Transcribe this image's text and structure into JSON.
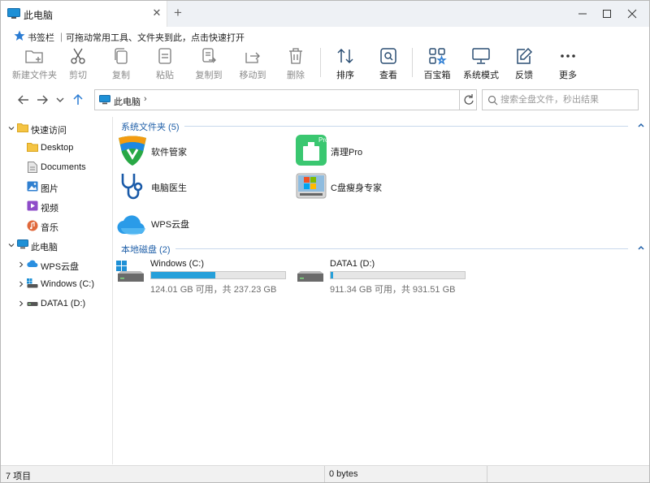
{
  "window": {
    "tab_title": "此电脑",
    "new_tab_glyph": "+",
    "close_tab_glyph": "✕"
  },
  "bookmark_bar": {
    "icon": "star-icon",
    "text": "书签栏 ｜可拖动常用工具、文件夹到此，点击快速打开"
  },
  "toolbar": {
    "items": [
      {
        "label": "新建文件夹",
        "icon": "new-folder-icon",
        "enabled": false
      },
      {
        "label": "剪切",
        "icon": "scissors-icon",
        "enabled": false
      },
      {
        "label": "复制",
        "icon": "copy-icon",
        "enabled": false
      },
      {
        "label": "粘贴",
        "icon": "paste-icon",
        "enabled": false
      },
      {
        "label": "复制到",
        "icon": "copy-to-icon",
        "enabled": false
      },
      {
        "label": "移动到",
        "icon": "move-to-icon",
        "enabled": false
      },
      {
        "label": "删除",
        "icon": "trash-icon",
        "enabled": false
      },
      {
        "label": "排序",
        "icon": "sort-icon",
        "enabled": true
      },
      {
        "label": "查看",
        "icon": "view-icon",
        "enabled": true
      },
      {
        "label": "百宝箱",
        "icon": "toolbox-icon",
        "enabled": true
      },
      {
        "label": "系统模式",
        "icon": "monitor-icon",
        "enabled": true
      },
      {
        "label": "反馈",
        "icon": "feedback-icon",
        "enabled": true
      },
      {
        "label": "更多",
        "icon": "more-icon",
        "enabled": true
      }
    ]
  },
  "address": {
    "path": "此电脑",
    "chevron": "›"
  },
  "search": {
    "placeholder": "搜索全盘文件，秒出结果"
  },
  "sidebar": {
    "quick_access": {
      "label": "快速访问",
      "items": [
        {
          "label": "Desktop",
          "icon": "folder-icon"
        },
        {
          "label": "Documents",
          "icon": "document-icon"
        },
        {
          "label": "图片",
          "icon": "image-icon"
        },
        {
          "label": "视频",
          "icon": "video-icon"
        },
        {
          "label": "音乐",
          "icon": "music-icon"
        }
      ]
    },
    "this_pc": {
      "label": "此电脑",
      "items": [
        {
          "label": "WPS云盘",
          "icon": "cloud-icon"
        },
        {
          "label": "Windows (C:)",
          "icon": "drive-icon"
        },
        {
          "label": "DATA1 (D:)",
          "icon": "drive-icon"
        }
      ]
    }
  },
  "main": {
    "system_folders": {
      "header": "系统文件夹 (5)",
      "items": [
        {
          "label": "软件管家"
        },
        {
          "label": "清理Pro"
        },
        {
          "label": "电脑医生"
        },
        {
          "label": "C盘瘦身专家"
        },
        {
          "label": "WPS云盘"
        }
      ]
    },
    "local_disks": {
      "header": "本地磁盘 (2)",
      "drives": [
        {
          "name": "Windows (C:)",
          "used_fraction": 0.477,
          "capacity_text": "124.01 GB 可用，共 237.23 GB"
        },
        {
          "name": "DATA1 (D:)",
          "used_fraction": 0.021,
          "capacity_text": "911.34 GB 可用，共 931.51 GB"
        }
      ]
    }
  },
  "status_bar": {
    "item_count": "7 项目",
    "size": "0 bytes"
  },
  "colors": {
    "accent": "#1f5fa8",
    "progress": "#26a0da",
    "folder": "#f5c443"
  }
}
